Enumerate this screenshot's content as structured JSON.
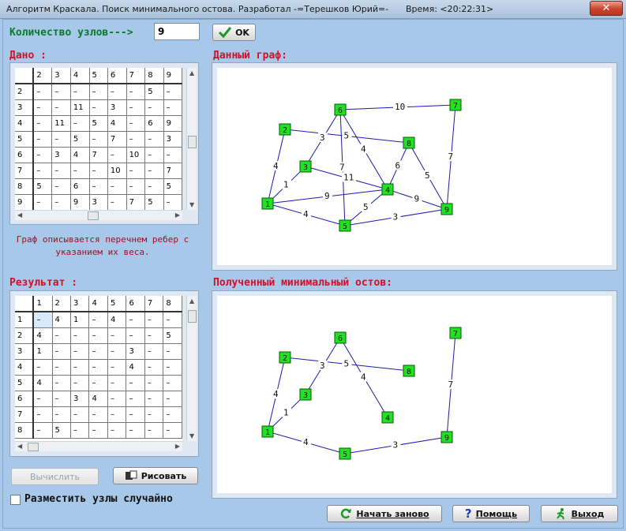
{
  "window": {
    "title": "Алгоритм Краскала. Поиск минимального остова. Разработал -=Терешков Юрий=-",
    "time": "Время: <20:22:31>",
    "close": "✕"
  },
  "controls": {
    "node_count_label": "Количество узлов--->",
    "node_count_value": "9",
    "ok_label": "OK",
    "given_label": "Дано :",
    "description": "Граф описывается перечнем ребер с указанием их веса.",
    "result_label": "Результат :",
    "calc_label": "Вычислить",
    "draw_label": "Рисовать",
    "random_label": "Разместить узлы случайно",
    "restart_label": "Начать заново",
    "help_label": "Помощь",
    "exit_label": "Выход"
  },
  "given_table": {
    "header": [
      "",
      "2",
      "3",
      "4",
      "5",
      "6",
      "7",
      "8",
      "9"
    ],
    "rows": [
      [
        "2",
        "–",
        "–",
        "–",
        "–",
        "–",
        "–",
        "5",
        "–"
      ],
      [
        "3",
        "–",
        "–",
        "11",
        "–",
        "3",
        "–",
        "–",
        "–"
      ],
      [
        "4",
        "–",
        "11",
        "–",
        "5",
        "4",
        "–",
        "6",
        "9"
      ],
      [
        "5",
        "–",
        "–",
        "5",
        "–",
        "7",
        "–",
        "–",
        "3"
      ],
      [
        "6",
        "–",
        "3",
        "4",
        "7",
        "–",
        "10",
        "–",
        "–"
      ],
      [
        "7",
        "–",
        "–",
        "–",
        "–",
        "10",
        "–",
        "–",
        "7"
      ],
      [
        "8",
        "5",
        "–",
        "6",
        "–",
        "–",
        "–",
        "–",
        "5"
      ],
      [
        "9",
        "–",
        "–",
        "9",
        "3",
        "–",
        "7",
        "5",
        "–"
      ]
    ]
  },
  "result_table": {
    "header": [
      "",
      "1",
      "2",
      "3",
      "4",
      "5",
      "6",
      "7",
      "8"
    ],
    "rows": [
      [
        "1",
        "–",
        "4",
        "1",
        "–",
        "4",
        "–",
        "–",
        "–"
      ],
      [
        "2",
        "4",
        "–",
        "–",
        "–",
        "–",
        "–",
        "–",
        "5"
      ],
      [
        "3",
        "1",
        "–",
        "–",
        "–",
        "–",
        "3",
        "–",
        "–"
      ],
      [
        "4",
        "–",
        "–",
        "–",
        "–",
        "–",
        "4",
        "–",
        "–"
      ],
      [
        "5",
        "4",
        "–",
        "–",
        "–",
        "–",
        "–",
        "–",
        "–"
      ],
      [
        "6",
        "–",
        "–",
        "3",
        "4",
        "–",
        "–",
        "–",
        "–"
      ],
      [
        "7",
        "–",
        "–",
        "–",
        "–",
        "–",
        "–",
        "–",
        "–"
      ],
      [
        "8",
        "–",
        "5",
        "–",
        "–",
        "–",
        "–",
        "–",
        "–"
      ]
    ]
  },
  "given_graph": {
    "title": "Данный граф:",
    "nodes": [
      "1",
      "2",
      "3",
      "4",
      "5",
      "6",
      "7",
      "8",
      "9"
    ],
    "edges": [
      {
        "a": "1",
        "b": "2",
        "w": "4"
      },
      {
        "a": "1",
        "b": "3",
        "w": "1"
      },
      {
        "a": "1",
        "b": "4",
        "w": "9"
      },
      {
        "a": "1",
        "b": "5",
        "w": "4"
      },
      {
        "a": "2",
        "b": "8",
        "w": "5"
      },
      {
        "a": "3",
        "b": "4",
        "w": "11"
      },
      {
        "a": "3",
        "b": "6",
        "w": "3"
      },
      {
        "a": "4",
        "b": "5",
        "w": "5"
      },
      {
        "a": "4",
        "b": "6",
        "w": "4"
      },
      {
        "a": "4",
        "b": "8",
        "w": "6"
      },
      {
        "a": "4",
        "b": "9",
        "w": "9"
      },
      {
        "a": "5",
        "b": "6",
        "w": "7"
      },
      {
        "a": "5",
        "b": "9",
        "w": "3"
      },
      {
        "a": "6",
        "b": "7",
        "w": "10"
      },
      {
        "a": "7",
        "b": "9",
        "w": "7"
      },
      {
        "a": "8",
        "b": "9",
        "w": "5"
      }
    ]
  },
  "result_graph": {
    "title": "Полученный минимальный остов:",
    "nodes": [
      "1",
      "2",
      "3",
      "4",
      "5",
      "6",
      "7",
      "8",
      "9"
    ],
    "edges": [
      {
        "a": "1",
        "b": "2",
        "w": "4"
      },
      {
        "a": "1",
        "b": "3",
        "w": "1"
      },
      {
        "a": "1",
        "b": "5",
        "w": "4"
      },
      {
        "a": "2",
        "b": "8",
        "w": "5"
      },
      {
        "a": "3",
        "b": "6",
        "w": "3"
      },
      {
        "a": "4",
        "b": "6",
        "w": "4"
      },
      {
        "a": "5",
        "b": "9",
        "w": "3"
      },
      {
        "a": "7",
        "b": "9",
        "w": "7"
      }
    ]
  },
  "colors": {
    "node_fill": "#22e022",
    "edge": "#1a1ab0",
    "label_green": "#0a7a2a",
    "label_red": "#d0102a"
  }
}
